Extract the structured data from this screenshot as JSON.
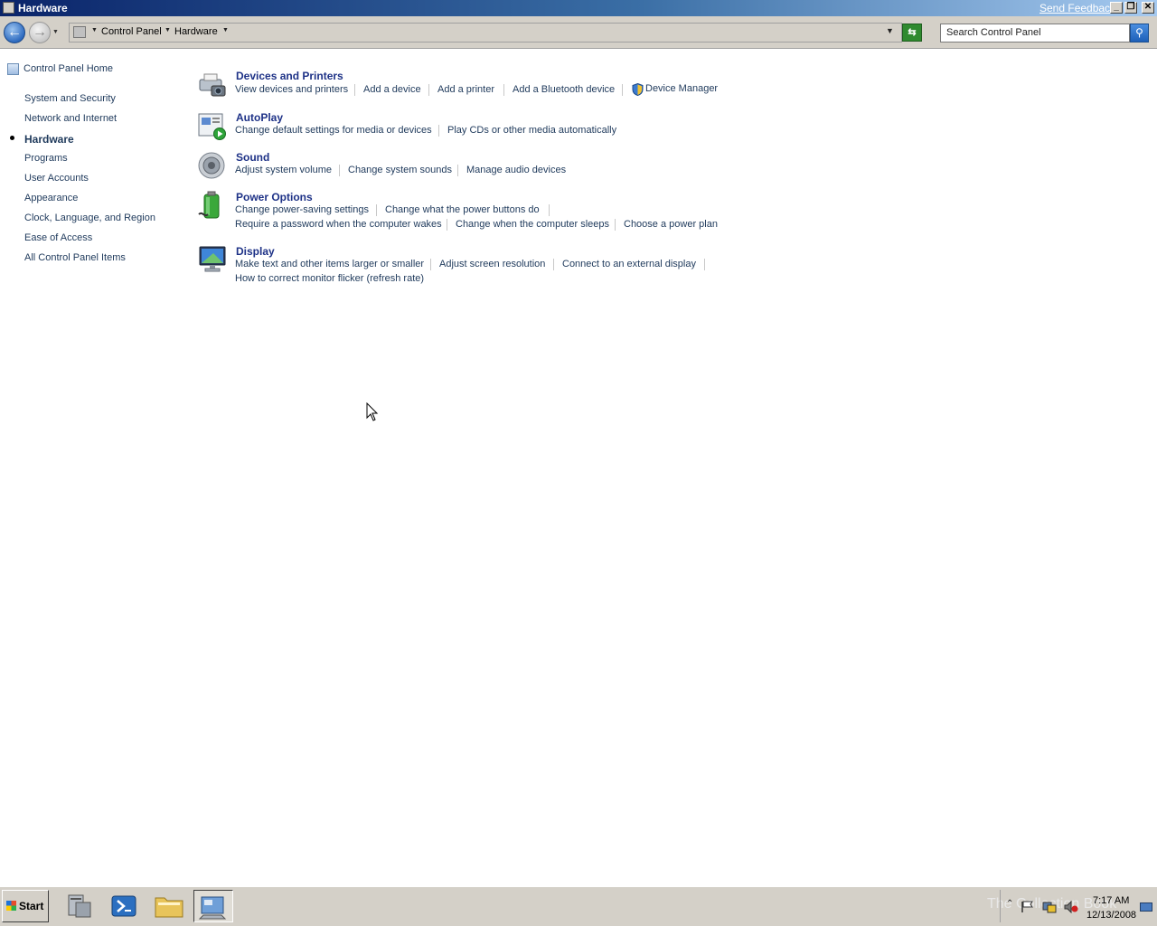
{
  "window": {
    "title": "Hardware",
    "send_feedback": "Send Feedback"
  },
  "nav": {
    "breadcrumbs": [
      "Control Panel",
      "Hardware"
    ],
    "search_placeholder": "Search Control Panel"
  },
  "sidebar": {
    "home": "Control Panel Home",
    "items": [
      {
        "label": "System and Security",
        "selected": false
      },
      {
        "label": "Network and Internet",
        "selected": false
      },
      {
        "label": "Hardware",
        "selected": true
      },
      {
        "label": "Programs",
        "selected": false
      },
      {
        "label": "User Accounts",
        "selected": false
      },
      {
        "label": "Appearance",
        "selected": false
      },
      {
        "label": "Clock, Language, and Region",
        "selected": false
      },
      {
        "label": "Ease of Access",
        "selected": false
      },
      {
        "label": "All Control Panel Items",
        "selected": false
      }
    ]
  },
  "categories": {
    "devices": {
      "title": "Devices and Printers",
      "links": [
        "View devices and printers",
        "Add a device",
        "Add a printer",
        "Add a Bluetooth device",
        "Device Manager"
      ]
    },
    "autoplay": {
      "title": "AutoPlay",
      "links": [
        "Change default settings for media or devices",
        "Play CDs or other media automatically"
      ]
    },
    "sound": {
      "title": "Sound",
      "links": [
        "Adjust system volume",
        "Change system sounds",
        "Manage audio devices"
      ]
    },
    "power": {
      "title": "Power Options",
      "links": [
        "Change power-saving settings",
        "Change what the power buttons do",
        "Require a password when the computer wakes",
        "Change when the computer sleeps",
        "Choose a power plan"
      ]
    },
    "display": {
      "title": "Display",
      "links": [
        "Make text and other items larger or smaller",
        "Adjust screen resolution",
        "Connect to an external display",
        "How to correct monitor flicker (refresh rate)"
      ]
    }
  },
  "taskbar": {
    "start_label": "Start",
    "watermark": "The Collection Book",
    "time": "7:17 AM",
    "date": "12/13/2008"
  },
  "colors": {
    "link": "#1e395b",
    "category_title": "#1e3287",
    "chrome": "#d4d0c8"
  }
}
